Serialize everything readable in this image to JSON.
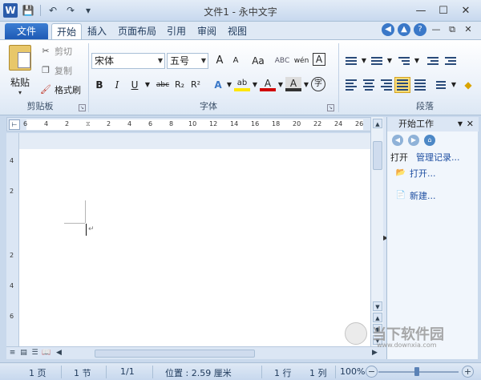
{
  "window": {
    "title": "文件1 - 永中文字",
    "app_letter": "W"
  },
  "qat": {
    "save": "💾",
    "undo": "↶",
    "redo": "↷",
    "more": "▾"
  },
  "window_controls": {
    "minimize": "—",
    "maximize": "☐",
    "close": "✕"
  },
  "tabs": [
    "文件",
    "开始",
    "插入",
    "页面布局",
    "引用",
    "审阅",
    "视图"
  ],
  "help_controls": {
    "nav": "◀",
    "up": "▲",
    "help": "?",
    "min": "—",
    "restore": "⧉",
    "close": "✕"
  },
  "clipboard": {
    "label": "剪贴板",
    "paste": "粘贴",
    "cut": "剪切",
    "copy": "复制",
    "format_painter": "格式刷"
  },
  "font": {
    "label": "字体",
    "family": "宋体",
    "size": "五号",
    "grow": "A",
    "shrink": "A",
    "case": "Aa",
    "bold": "B",
    "italic": "I",
    "underline": "U",
    "strike": "abc",
    "subscript": "R₂",
    "superscript": "R²",
    "effects": "A",
    "highlight": "ab",
    "color": "A",
    "shading": "A",
    "enclose": "字"
  },
  "paragraph": {
    "label": "段落"
  },
  "ruler_ticks": [
    "6",
    "4",
    "2",
    "2",
    "4",
    "6",
    "8",
    "10",
    "12",
    "14",
    "16",
    "18",
    "20",
    "22",
    "24",
    "26"
  ],
  "vruler_ticks": [
    "4",
    "2",
    "2",
    "4",
    "6"
  ],
  "task_pane": {
    "title": "开始工作",
    "tab_open": "打开",
    "tab_manage": "管理记录...",
    "open_link": "打开...",
    "new_link": "新建..."
  },
  "status": {
    "page": "1 页",
    "section": "1 节",
    "pages": "1/1",
    "position": "位置 : 2.59 厘米",
    "line": "1 行",
    "column": "1 列",
    "zoom": "100%",
    "zoom_out": "−",
    "zoom_in": "+"
  },
  "watermark": {
    "text": "当下软件园",
    "url": "www.downxia.com"
  }
}
